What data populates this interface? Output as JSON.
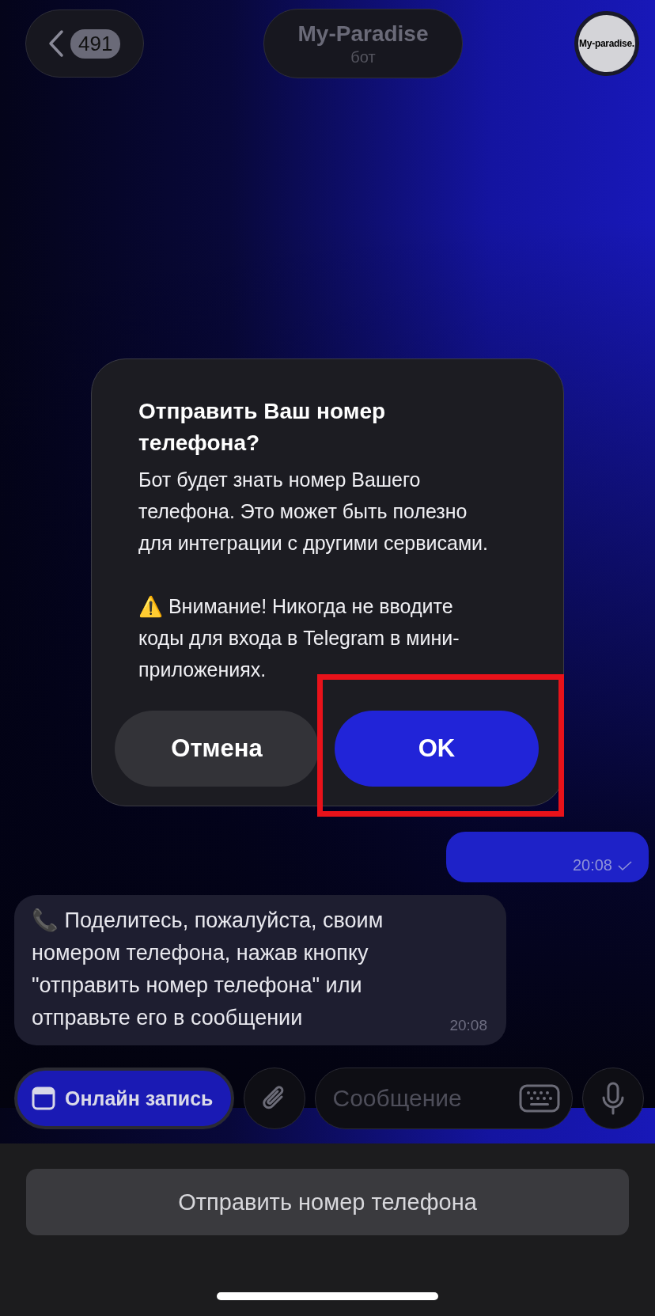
{
  "header": {
    "back_count": "491",
    "title": "My-Paradise",
    "subtitle": "бот",
    "avatar_text": "My-paradise."
  },
  "dialog": {
    "title": "Отправить Ваш номер телефона?",
    "body": "Бот будет знать номер Вашего телефона. Это может быть полезно для интеграции с другими сервисами.",
    "warning_icon": "⚠️",
    "warning": "Внимание! Никогда не вводите коды для входа в Telegram в мини-приложениях.",
    "buttons": [
      {
        "label": "Отмена",
        "kind": "secondary",
        "highlighted": false
      },
      {
        "label": "OK",
        "kind": "primary",
        "highlighted": true
      }
    ]
  },
  "messages": [
    {
      "kind": "outgoing",
      "time": "20:08",
      "read": false
    },
    {
      "kind": "incoming",
      "icon": "📞",
      "text": "Поделитесь, пожалуйста, своим номером телефона, нажав кнопку \"отправить номер телефона\" или отправьте его в сообщении",
      "time": "20:08"
    }
  ],
  "composer": {
    "app_button": "Онлайн запись",
    "placeholder": "Сообщение"
  },
  "keyboard_button": "Отправить номер телефона"
}
